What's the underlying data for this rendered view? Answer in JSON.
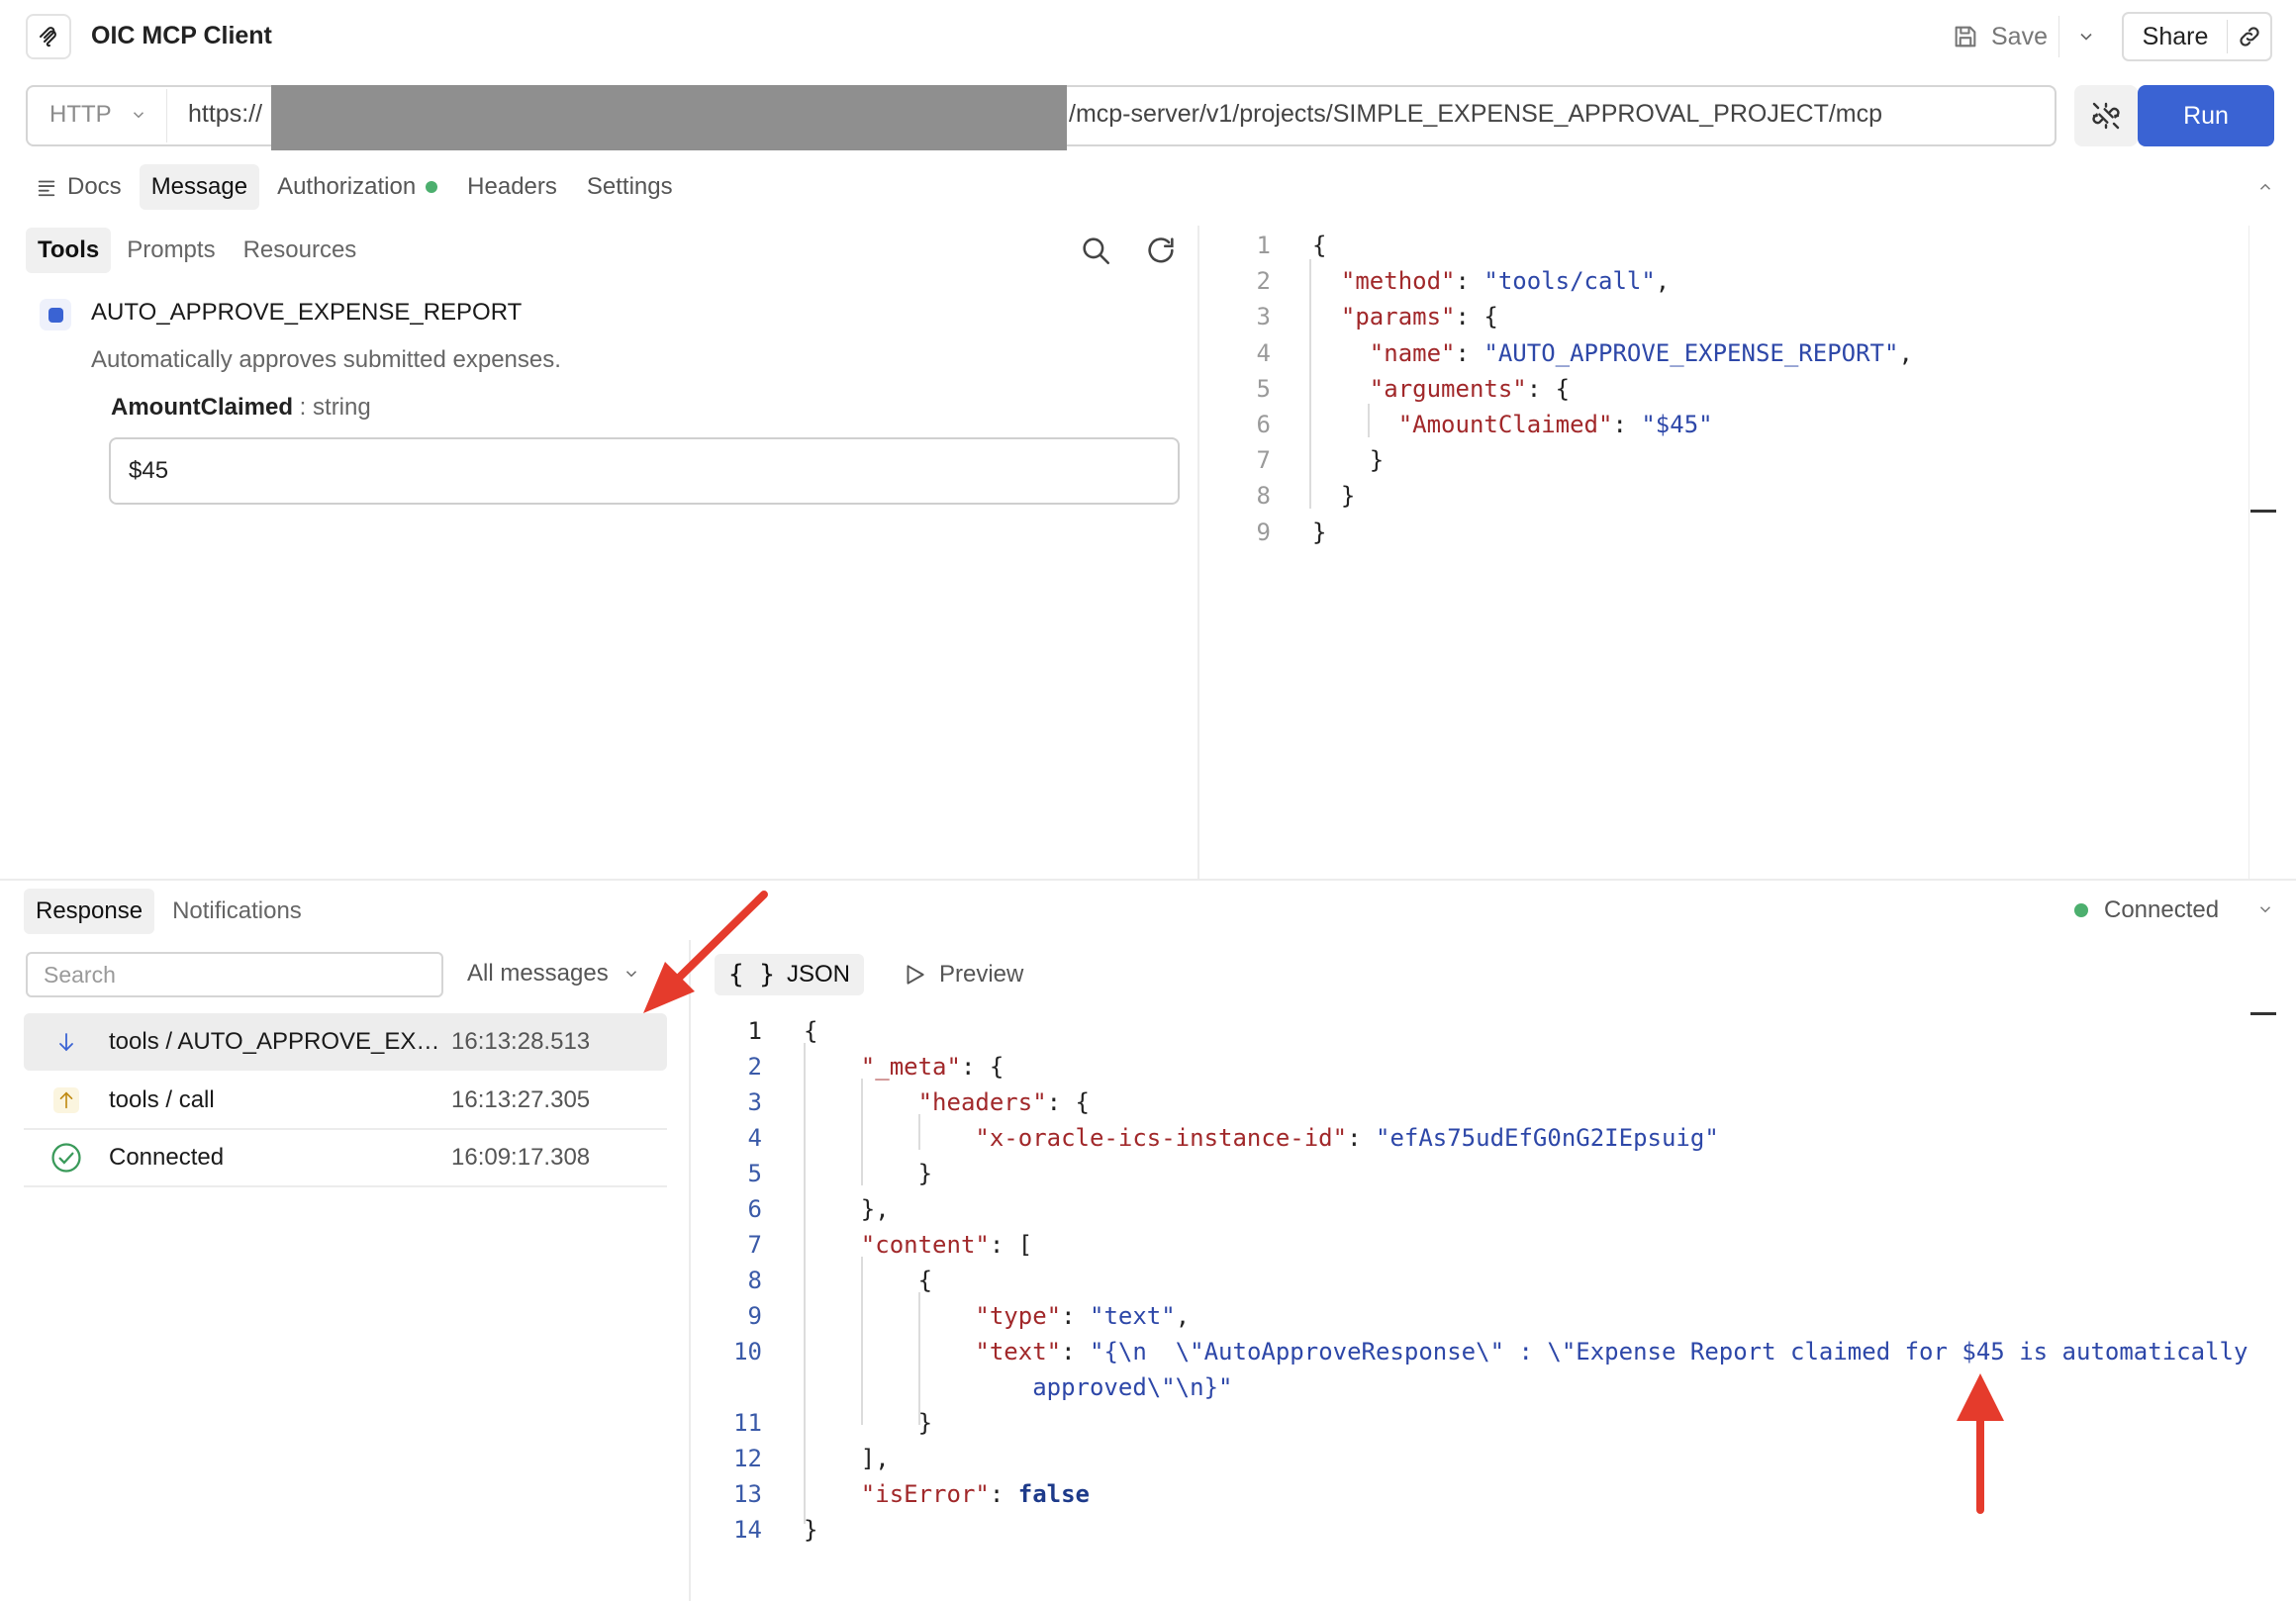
{
  "app": {
    "title": "OIC MCP Client"
  },
  "toolbar": {
    "save_label": "Save",
    "share_label": "Share"
  },
  "url_bar": {
    "method": "HTTP",
    "url_prefix": "https://",
    "url_suffix": "/mcp-server/v1/projects/SIMPLE_EXPENSE_APPROVAL_PROJECT/mcp",
    "run_label": "Run"
  },
  "request_tabs": [
    {
      "label": "Docs"
    },
    {
      "label": "Message"
    },
    {
      "label": "Authorization"
    },
    {
      "label": "Headers"
    },
    {
      "label": "Settings"
    }
  ],
  "message_tabs": [
    {
      "label": "Tools"
    },
    {
      "label": "Prompts"
    },
    {
      "label": "Resources"
    }
  ],
  "tool": {
    "name": "AUTO_APPROVE_EXPENSE_REPORT",
    "description": "Automatically approves submitted expenses.",
    "param_name": "AmountClaimed",
    "param_type": " : string",
    "param_value": "$45"
  },
  "request_json": [
    "{",
    "  \"method\": \"tools/call\",",
    "  \"params\": {",
    "    \"name\": \"AUTO_APPROVE_EXPENSE_REPORT\",",
    "    \"arguments\": {",
    "      \"AmountClaimed\": \"$45\"",
    "    }",
    "  }",
    "}"
  ],
  "response_tabs": [
    {
      "label": "Response"
    },
    {
      "label": "Notifications"
    }
  ],
  "connection": {
    "status": "Connected",
    "color": "#4caf6e"
  },
  "messages": {
    "search_placeholder": "Search",
    "filter_label": "All messages",
    "items": [
      {
        "title": "tools / AUTO_APPROVE_EXPENSE_REPORT",
        "time": "16:13:28.513",
        "icon": "arrow-down-icon"
      },
      {
        "title": "tools / call",
        "time": "16:13:27.305",
        "icon": "arrow-up-icon"
      },
      {
        "title": "Connected",
        "time": "16:09:17.308",
        "icon": "check-circle-icon"
      }
    ]
  },
  "view_tabs": {
    "json_label": "JSON",
    "preview_label": "Preview"
  },
  "response_json": {
    "instance_id": "efAs75udEfG0nG2IEpsuig",
    "type_value": "text",
    "text_line_a": "\"{\\n  \\\"AutoApproveResponse\\\" : \\\"Expense Report claimed for $45 is automatically",
    "text_line_b": "approved\\\"\\n}\"",
    "is_error": "false"
  },
  "colors": {
    "accent": "#3a63d3",
    "annotation": "#e53b2c",
    "json_key": "#a1282a",
    "json_string": "#2d47a8"
  }
}
